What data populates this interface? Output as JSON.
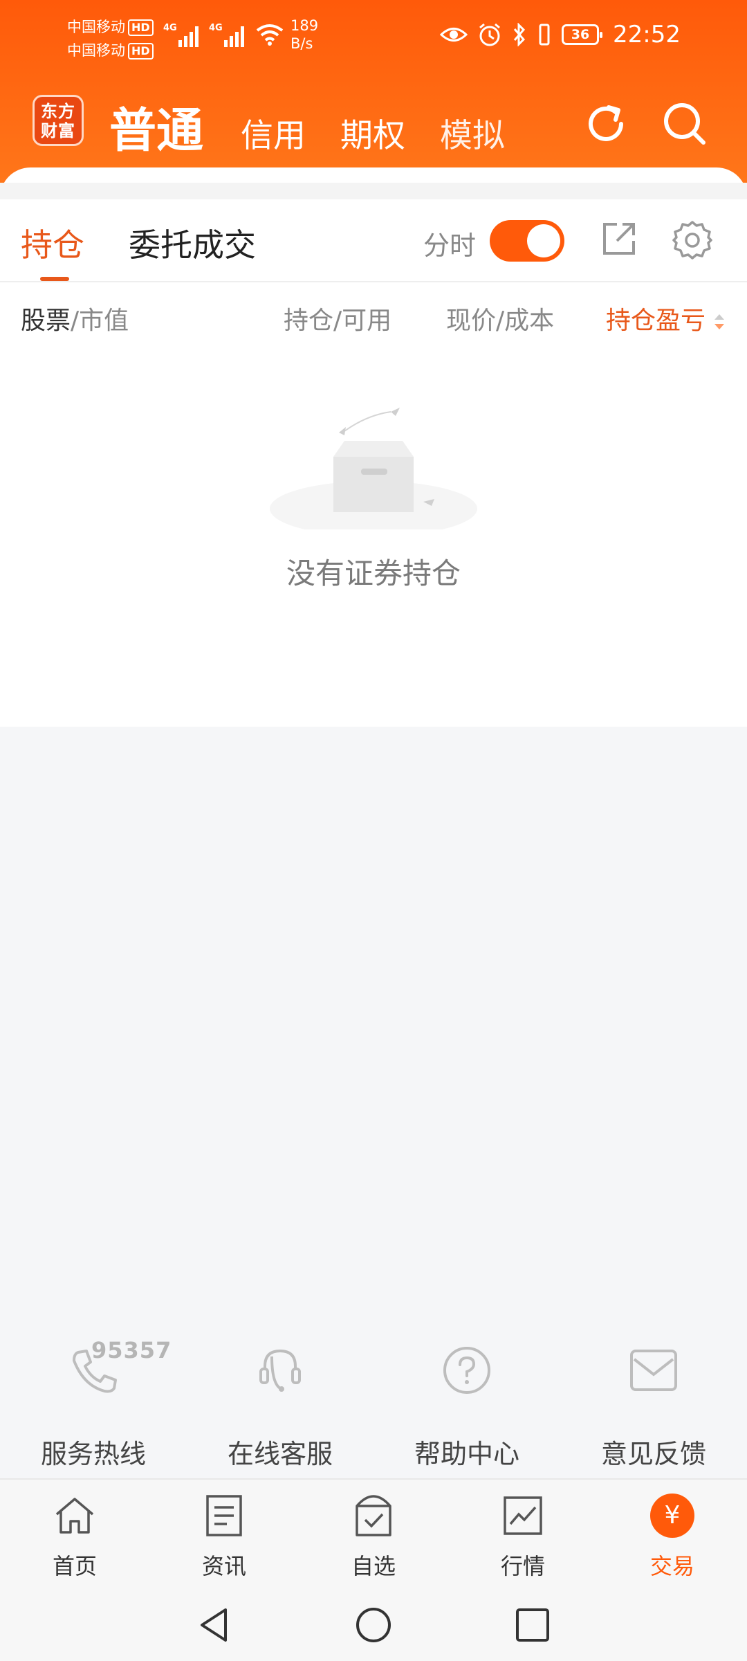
{
  "status_bar": {
    "carrier1": "中国移动",
    "carrier2": "中国移动",
    "hd": "HD",
    "net_type": "4G",
    "speed_value": "189",
    "speed_unit": "B/s",
    "battery": "36",
    "time": "22:52"
  },
  "app": {
    "logo_line1": "东方",
    "logo_line2": "财富",
    "tabs": [
      "普通",
      "信用",
      "期权",
      "模拟"
    ],
    "active_tab": "普通"
  },
  "positions": {
    "subtabs": [
      "持仓",
      "委托成交"
    ],
    "fenshi_label": "分时",
    "fenshi_on": true,
    "columns": {
      "stock": "股票",
      "market_value": "/市值",
      "hold_available": "持仓/可用",
      "price_cost": "现价/成本",
      "pnl": "持仓盈亏"
    },
    "empty_text": "没有证券持仓"
  },
  "services": {
    "hotline_number": "95357",
    "items": [
      "服务热线",
      "在线客服",
      "帮助中心",
      "意见反馈"
    ]
  },
  "tabbar": {
    "items": [
      "首页",
      "资讯",
      "自选",
      "行情",
      "交易"
    ],
    "active": "交易",
    "trade_symbol": "¥"
  },
  "colors": {
    "brand_orange": "#ff5a0a",
    "active_text": "#e8581a",
    "muted": "#888888"
  }
}
